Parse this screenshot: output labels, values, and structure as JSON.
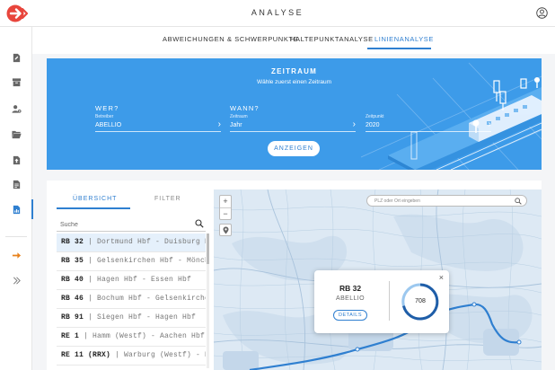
{
  "header": {
    "app_title": "ANALYSE"
  },
  "tabs": [
    {
      "label": "ABWEICHUNGEN & SCHWERPUNKTE",
      "active": false
    },
    {
      "label": "HALTEPUNKTANALYSE",
      "active": false
    },
    {
      "label": "LINIENANALYSE",
      "active": true
    }
  ],
  "hero": {
    "title": "ZEITRAUM",
    "subtitle": "Wähle zuerst einen Zeitraum",
    "who_label": "WER?",
    "when_label": "WANN?",
    "fields": [
      {
        "label": "Betreiber",
        "value": "ABELLIO"
      },
      {
        "label": "Zeitraum",
        "value": "Jahr"
      },
      {
        "label": "Zeitpunkt",
        "value": "2020"
      }
    ],
    "show_button": "ANZEIGEN"
  },
  "panel": {
    "tab_overview": "ÜBERSICHT",
    "tab_filter": "FILTER",
    "search_placeholder": "Suche",
    "lines": [
      {
        "code": "RB 32",
        "route": "Dortmund Hbf - Duisburg Hbf",
        "selected": true
      },
      {
        "code": "RB 35",
        "route": "Gelsenkirchen Hbf - Mönchengladbach Hbf",
        "selected": false
      },
      {
        "code": "RB 40",
        "route": "Hagen Hbf - Essen Hbf",
        "selected": false
      },
      {
        "code": "RB 46",
        "route": "Bochum Hbf - Gelsenkirchen Hbf",
        "selected": false
      },
      {
        "code": "RB 91",
        "route": "Siegen Hbf - Hagen Hbf",
        "selected": false
      },
      {
        "code": "RE 1",
        "route": "Hamm (Westf) - Aachen Hbf",
        "selected": false
      },
      {
        "code": "RE 11 (RRX)",
        "route": "Warburg (Westf) - Düsseldorf Hbf",
        "selected": false
      }
    ]
  },
  "map": {
    "zoom_in": "+",
    "zoom_out": "−",
    "search_placeholder": "PLZ oder Ort eingeben",
    "popup": {
      "line": "RB 32",
      "operator": "ABELLIO",
      "details_button": "DETAILS",
      "value": "708",
      "close": "×"
    }
  },
  "colors": {
    "accent": "#2f7fd0",
    "hero_bg": "#3d9be9",
    "logo_red": "#e8453c"
  }
}
